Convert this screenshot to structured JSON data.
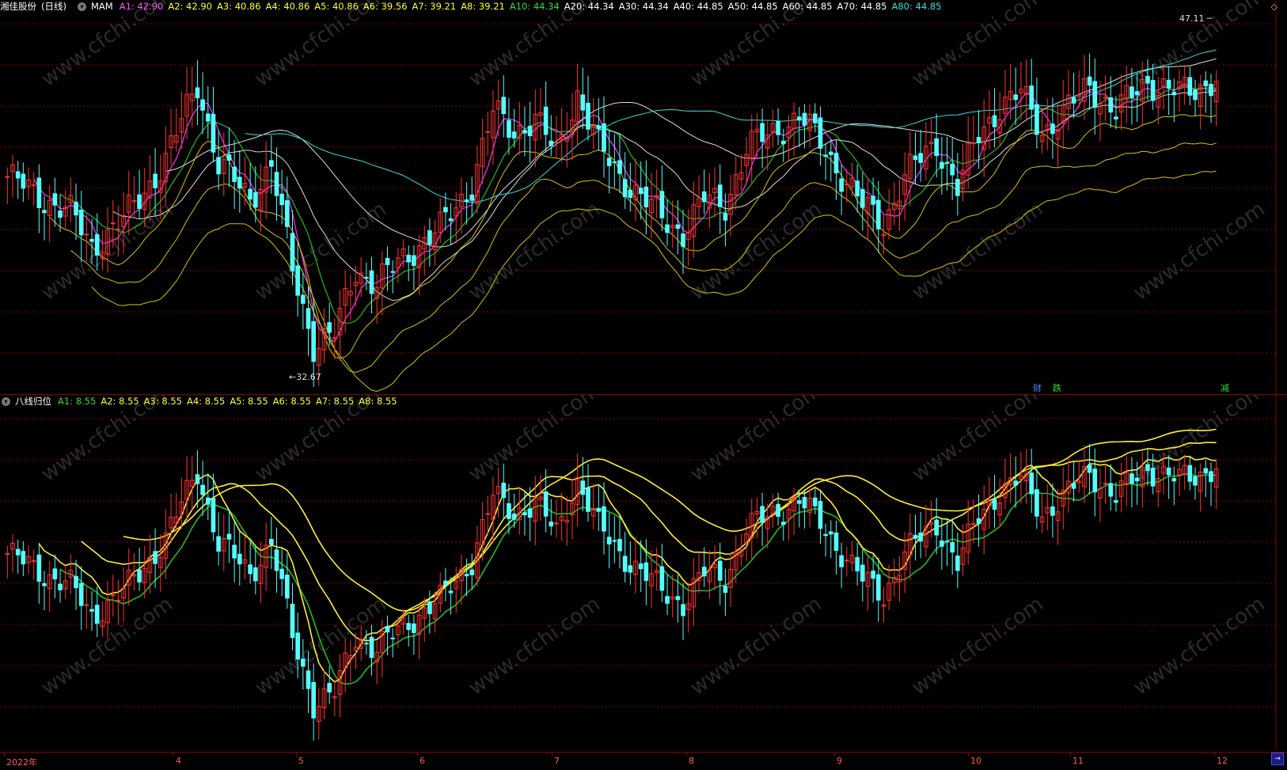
{
  "stock": {
    "name": "湘佳股份",
    "period": "(日线)",
    "main_indicator": "MAM",
    "main_values": [
      {
        "label": "A1:",
        "value": "42.90",
        "color": "#ff55ff"
      },
      {
        "label": "A2:",
        "value": "42.90",
        "color": "#ffff33"
      },
      {
        "label": "A3:",
        "value": "40.86",
        "color": "#ffff33"
      },
      {
        "label": "A4:",
        "value": "40.86",
        "color": "#ffff33"
      },
      {
        "label": "A5:",
        "value": "40.86",
        "color": "#ffff33"
      },
      {
        "label": "A6:",
        "value": "39.56",
        "color": "#ffff33"
      },
      {
        "label": "A7:",
        "value": "39.21",
        "color": "#ffff33"
      },
      {
        "label": "A8:",
        "value": "39.21",
        "color": "#ffff33"
      },
      {
        "label": "A10:",
        "value": "44.34",
        "color": "#33dd33"
      },
      {
        "label": "A20:",
        "value": "44.34",
        "color": "#ffffff"
      },
      {
        "label": "A30:",
        "value": "44.34",
        "color": "#ffffff"
      },
      {
        "label": "A40:",
        "value": "44.85",
        "color": "#ffffff"
      },
      {
        "label": "A50:",
        "value": "44.85",
        "color": "#ffffff"
      },
      {
        "label": "A60:",
        "value": "44.85",
        "color": "#ffffff"
      },
      {
        "label": "A70:",
        "value": "44.85",
        "color": "#ffffff"
      },
      {
        "label": "A80:",
        "value": "44.85",
        "color": "#33dddd"
      }
    ],
    "high_label": "47.11",
    "low_label": "32.67",
    "markers": [
      {
        "text": "财",
        "color": "#4488ff"
      },
      {
        "text": "跌",
        "color": "#33dd33"
      },
      {
        "text": "减",
        "color": "#33dd33"
      }
    ]
  },
  "sub": {
    "indicator": "八线归位",
    "values": [
      {
        "label": "A1:",
        "value": "8.55",
        "color": "#33dd33"
      },
      {
        "label": "A2:",
        "value": "8.55",
        "color": "#ffff33"
      },
      {
        "label": "A3:",
        "value": "8.55",
        "color": "#ffff33"
      },
      {
        "label": "A4:",
        "value": "8.55",
        "color": "#ffff33"
      },
      {
        "label": "A5:",
        "value": "8.55",
        "color": "#ffff33"
      },
      {
        "label": "A6:",
        "value": "8.55",
        "color": "#ffff33"
      },
      {
        "label": "A7:",
        "value": "8.55",
        "color": "#ffff33"
      },
      {
        "label": "A8:",
        "value": "8.55",
        "color": "#ffff33"
      }
    ]
  },
  "time_axis": {
    "labels": [
      "2022年",
      "4",
      "5",
      "6",
      "7",
      "8",
      "9",
      "10",
      "11",
      "12"
    ]
  },
  "colors": {
    "up": "#ff3333",
    "down": "#54ffff",
    "grid": "#8a0000",
    "ma_white": "#dddddd",
    "ma_green": "#22bb22",
    "ma_magenta": "#ff33ff",
    "ma_yellow": "#d4c400",
    "ma_cyan": "#33dddd"
  },
  "watermark": "www.cfchi.com"
}
